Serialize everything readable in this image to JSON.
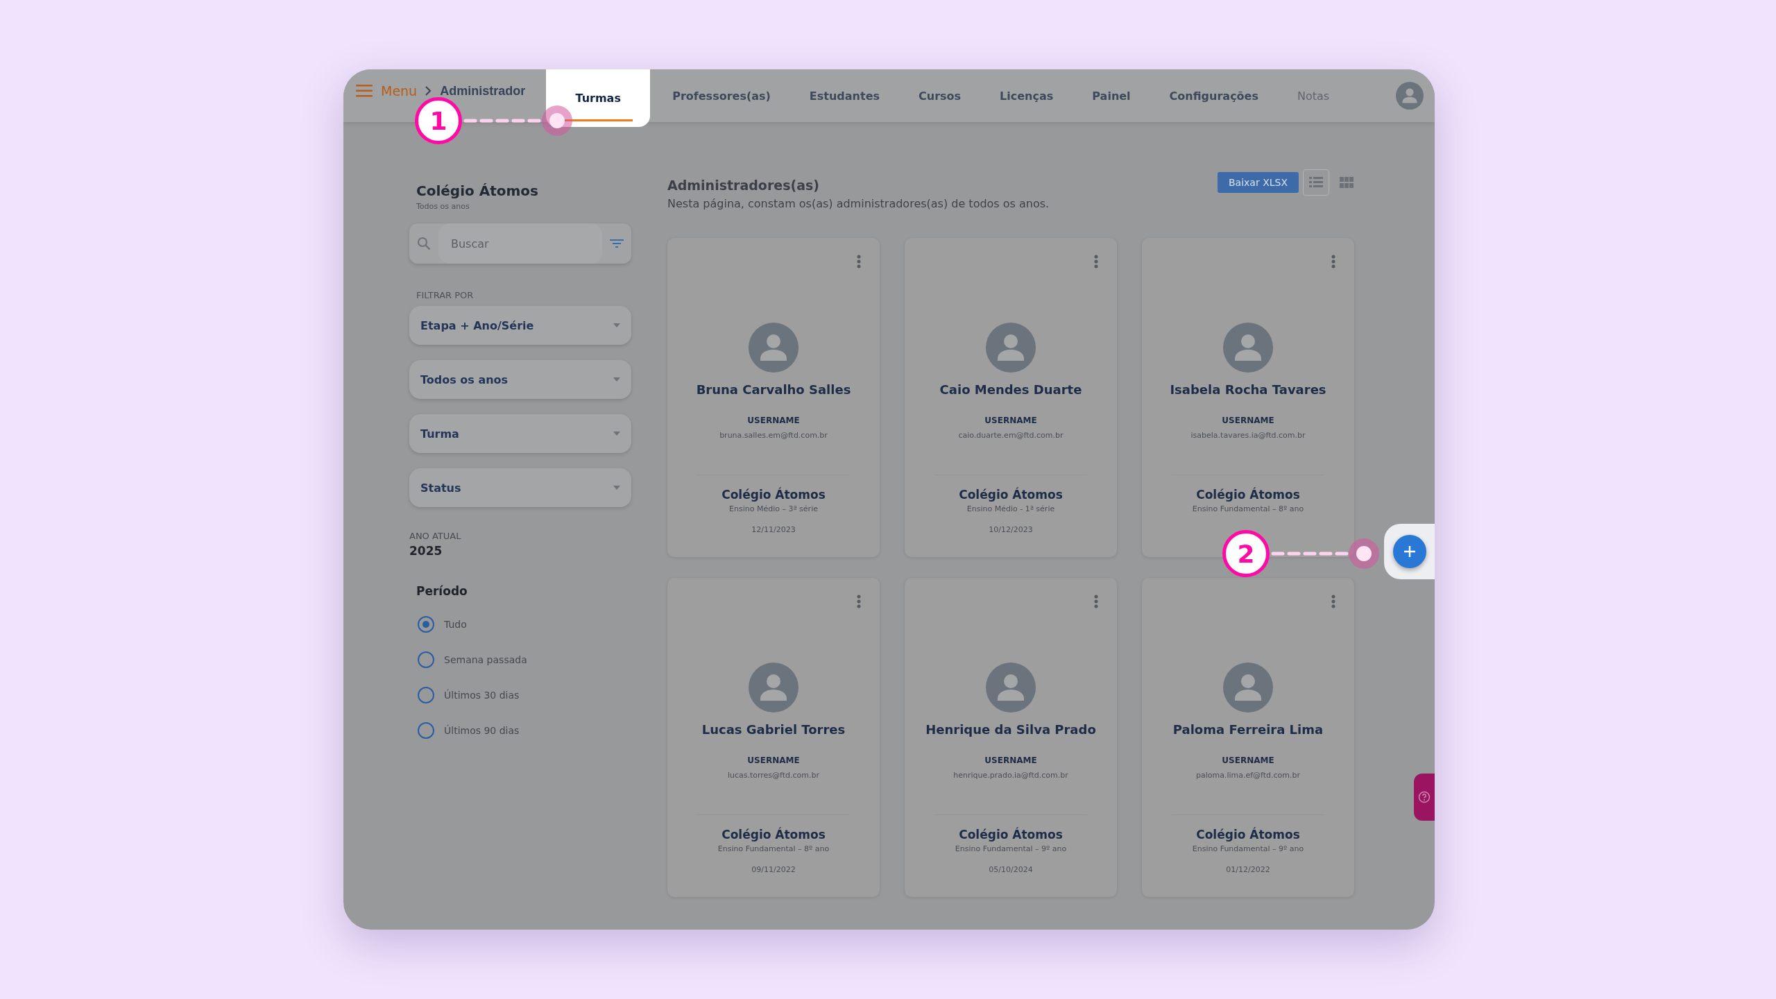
{
  "header": {
    "menu_label": "Menu",
    "breadcrumb": "Administrador",
    "tabs": [
      {
        "label": "Turmas",
        "selected": true,
        "disabled": false
      },
      {
        "label": "Professores(as)",
        "selected": false,
        "disabled": false
      },
      {
        "label": "Estudantes",
        "selected": false,
        "disabled": false
      },
      {
        "label": "Cursos",
        "selected": false,
        "disabled": false
      },
      {
        "label": "Licenças",
        "selected": false,
        "disabled": false
      },
      {
        "label": "Painel",
        "selected": false,
        "disabled": false
      },
      {
        "label": "Configurações",
        "selected": false,
        "disabled": false
      },
      {
        "label": "Notas",
        "selected": false,
        "disabled": true
      }
    ]
  },
  "sidebar": {
    "school": "Colégio Átomos",
    "subtitle": "Todos os anos",
    "search": {
      "placeholder": "Buscar"
    },
    "filter_label": "FILTRAR POR",
    "dropdowns": [
      "Etapa + Ano/Série",
      "Todos os anos",
      "Turma",
      "Status"
    ],
    "year_label": "ANO ATUAL",
    "year": "2025",
    "period_title": "Período",
    "period_options": [
      {
        "label": "Tudo",
        "selected": true
      },
      {
        "label": "Semana passada",
        "selected": false
      },
      {
        "label": "Últimos 30 dias",
        "selected": false
      },
      {
        "label": "Últimos 90 dias",
        "selected": false
      }
    ]
  },
  "main": {
    "title": "Administradores(as)",
    "description": "Nesta página, constam os(as) administradores(as) de todos os anos.",
    "download_button": "Baixar XLSX",
    "views": [
      {
        "kind": "list",
        "selected": true
      },
      {
        "kind": "grid",
        "selected": false
      }
    ],
    "cards": [
      {
        "name": "Bruna Carvalho Salles",
        "username_label": "USERNAME",
        "email": "bruna.salles.em@ftd.com.br",
        "school": "Colégio Átomos",
        "grade": "Ensino Médio – 3ª série",
        "date": "12/11/2023"
      },
      {
        "name": "Caio Mendes Duarte",
        "username_label": "USERNAME",
        "email": "caio.duarte.em@ftd.com.br",
        "school": "Colégio Átomos",
        "grade": "Ensino Médio - 1ª série",
        "date": "10/12/2023"
      },
      {
        "name": "Isabela Rocha Tavares",
        "username_label": "USERNAME",
        "email": "isabela.tavares.ia@ftd.com.br",
        "school": "Colégio Átomos",
        "grade": "Ensino Fundamental – 8º ano"
      },
      {
        "name": "Lucas Gabriel Torres",
        "username_label": "USERNAME",
        "email": "lucas.torres@ftd.com.br",
        "school": "Colégio Átomos",
        "grade": "Ensino Fundamental – 8º ano",
        "date": "09/11/2022"
      },
      {
        "name": "Henrique da Silva Prado",
        "username_label": "USERNAME",
        "email": "henrique.prado.ia@ftd.com.br",
        "school": "Colégio Átomos",
        "grade": "Ensino Fundamental – 9º ano",
        "date": "05/10/2024"
      },
      {
        "name": "Paloma Ferreira Lima",
        "username_label": "USERNAME",
        "email": "paloma.lima.ef@ftd.com.br",
        "school": "Colégio Átomos",
        "grade": "Ensino Fundamental – 9º ano",
        "date": "01/12/2022"
      }
    ]
  },
  "callouts": [
    {
      "number": "1"
    },
    {
      "number": "2"
    }
  ]
}
